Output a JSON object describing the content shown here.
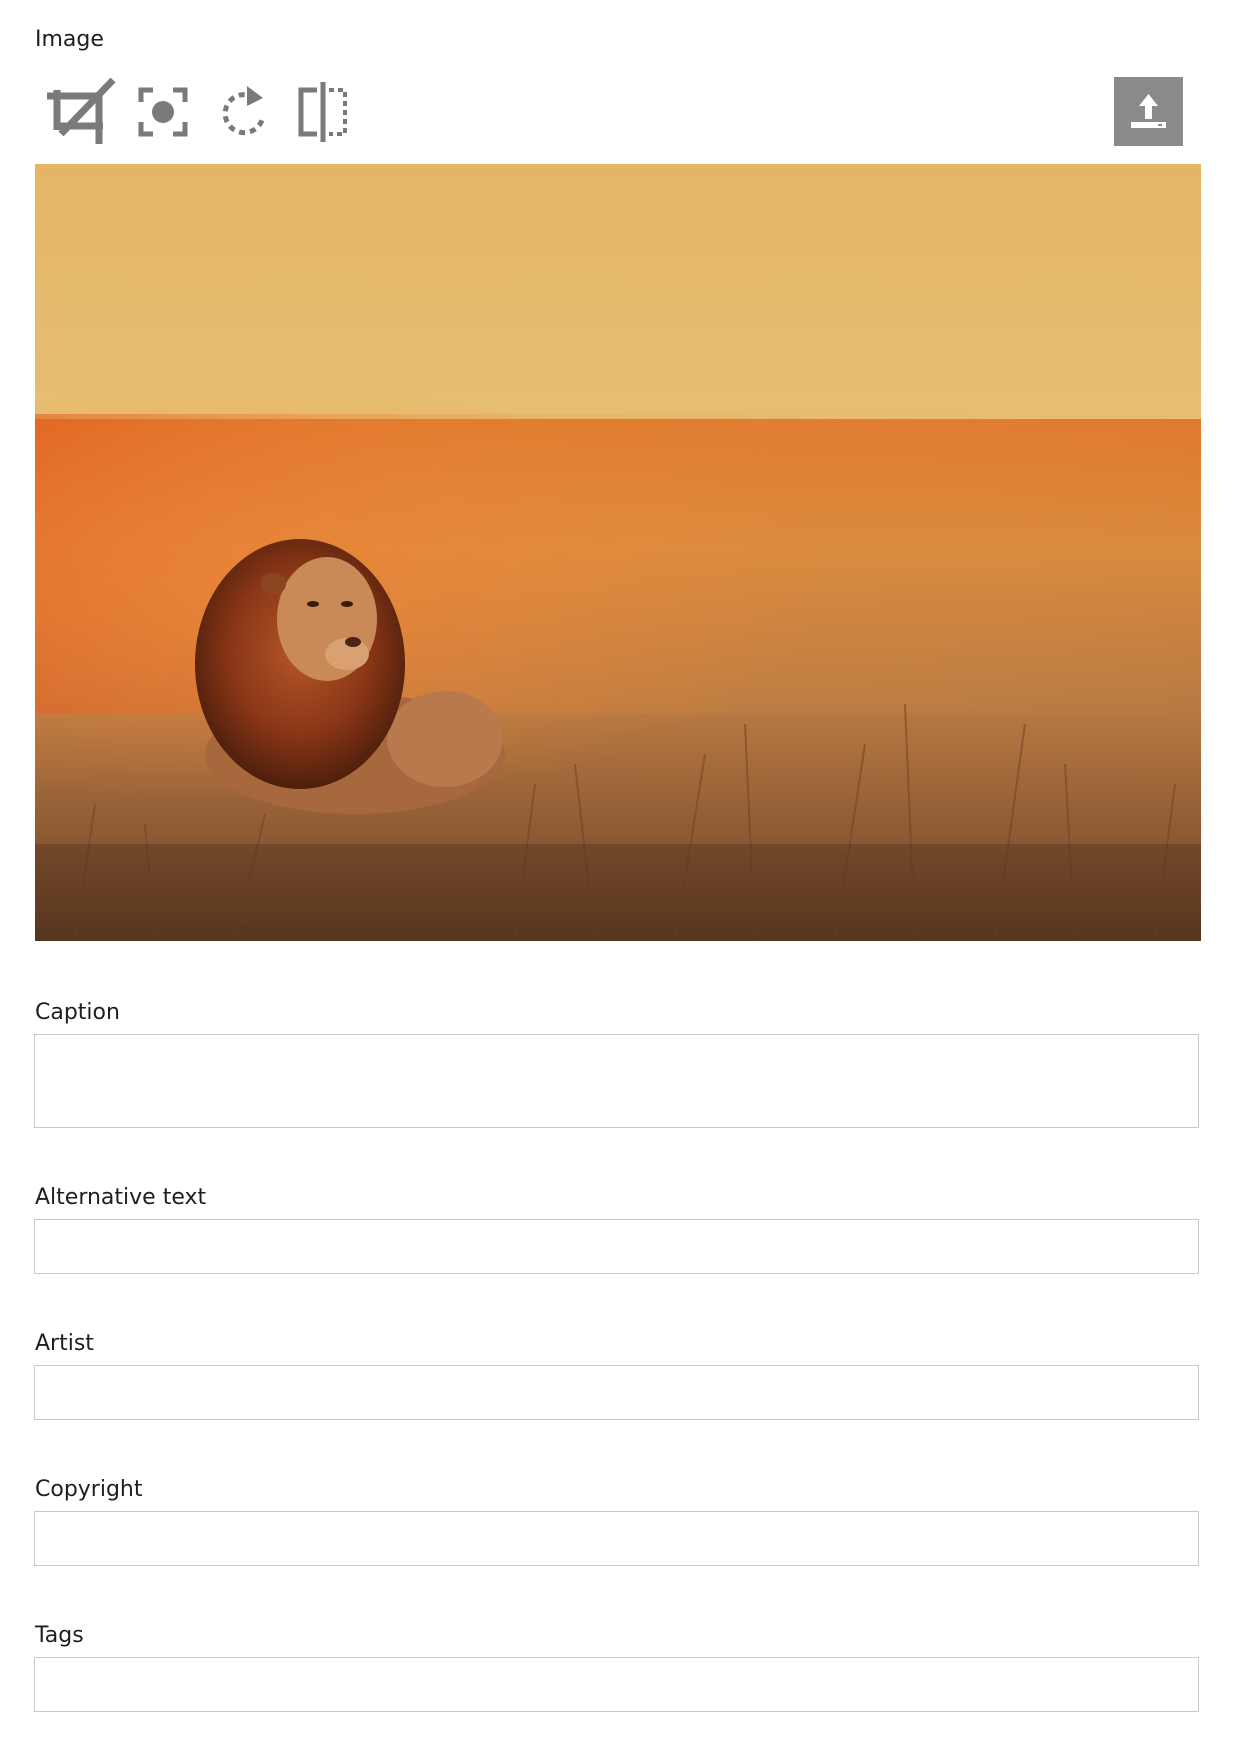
{
  "image_section": {
    "label": "Image"
  },
  "toolbar": {
    "tools": [
      {
        "icon": "crop-icon"
      },
      {
        "icon": "focus-point-icon"
      },
      {
        "icon": "rotate-icon"
      },
      {
        "icon": "flip-horizontal-icon"
      }
    ],
    "upload_icon": "upload-icon",
    "icon_color": "#7a7a7a",
    "upload_bg": "#8a8a8a"
  },
  "fields": {
    "caption": {
      "label": "Caption",
      "value": ""
    },
    "alt_text": {
      "label": "Alternative text",
      "value": ""
    },
    "artist": {
      "label": "Artist",
      "value": ""
    },
    "copyright": {
      "label": "Copyright",
      "value": ""
    },
    "tags": {
      "label": "Tags",
      "value": ""
    }
  },
  "colors": {
    "border": "#c9c9c9",
    "text": "#1f1f1f"
  }
}
